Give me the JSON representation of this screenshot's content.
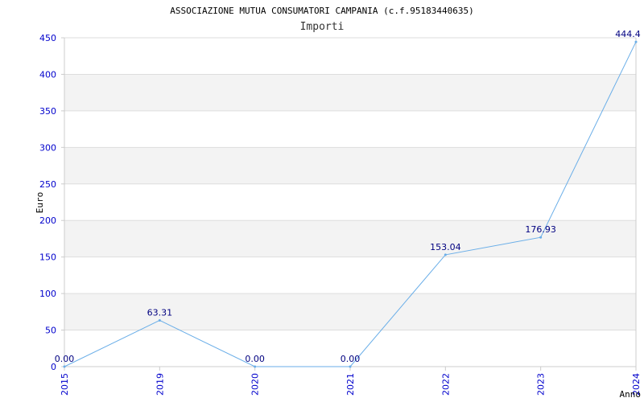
{
  "chart_data": {
    "type": "line",
    "title": "ASSOCIAZIONE MUTUA CONSUMATORI CAMPANIA (c.f.95183440635)",
    "subtitle": "Importi",
    "xlabel": "Anno",
    "ylabel": "Euro",
    "categories": [
      "2015",
      "2019",
      "2020",
      "2021",
      "2022",
      "2023",
      "2024"
    ],
    "series": [
      {
        "values": [
          0.0,
          63.31,
          0.0,
          0.0,
          153.04,
          176.93,
          444.4
        ],
        "labels": [
          "0.00",
          "63.31",
          "0.00",
          "0.00",
          "153.04",
          "176.93",
          "444.4"
        ]
      }
    ],
    "ylim": [
      0,
      450
    ],
    "yticks": [
      "0",
      "50",
      "100",
      "150",
      "200",
      "250",
      "300",
      "350",
      "400",
      "450"
    ],
    "grid": true,
    "colors": {
      "line": "#6aaee8",
      "tick_text": "#0000cc",
      "data_label": "#000080",
      "band": "#f3f3f3",
      "gridline": "#dddddd",
      "axis": "#cccccc"
    }
  }
}
